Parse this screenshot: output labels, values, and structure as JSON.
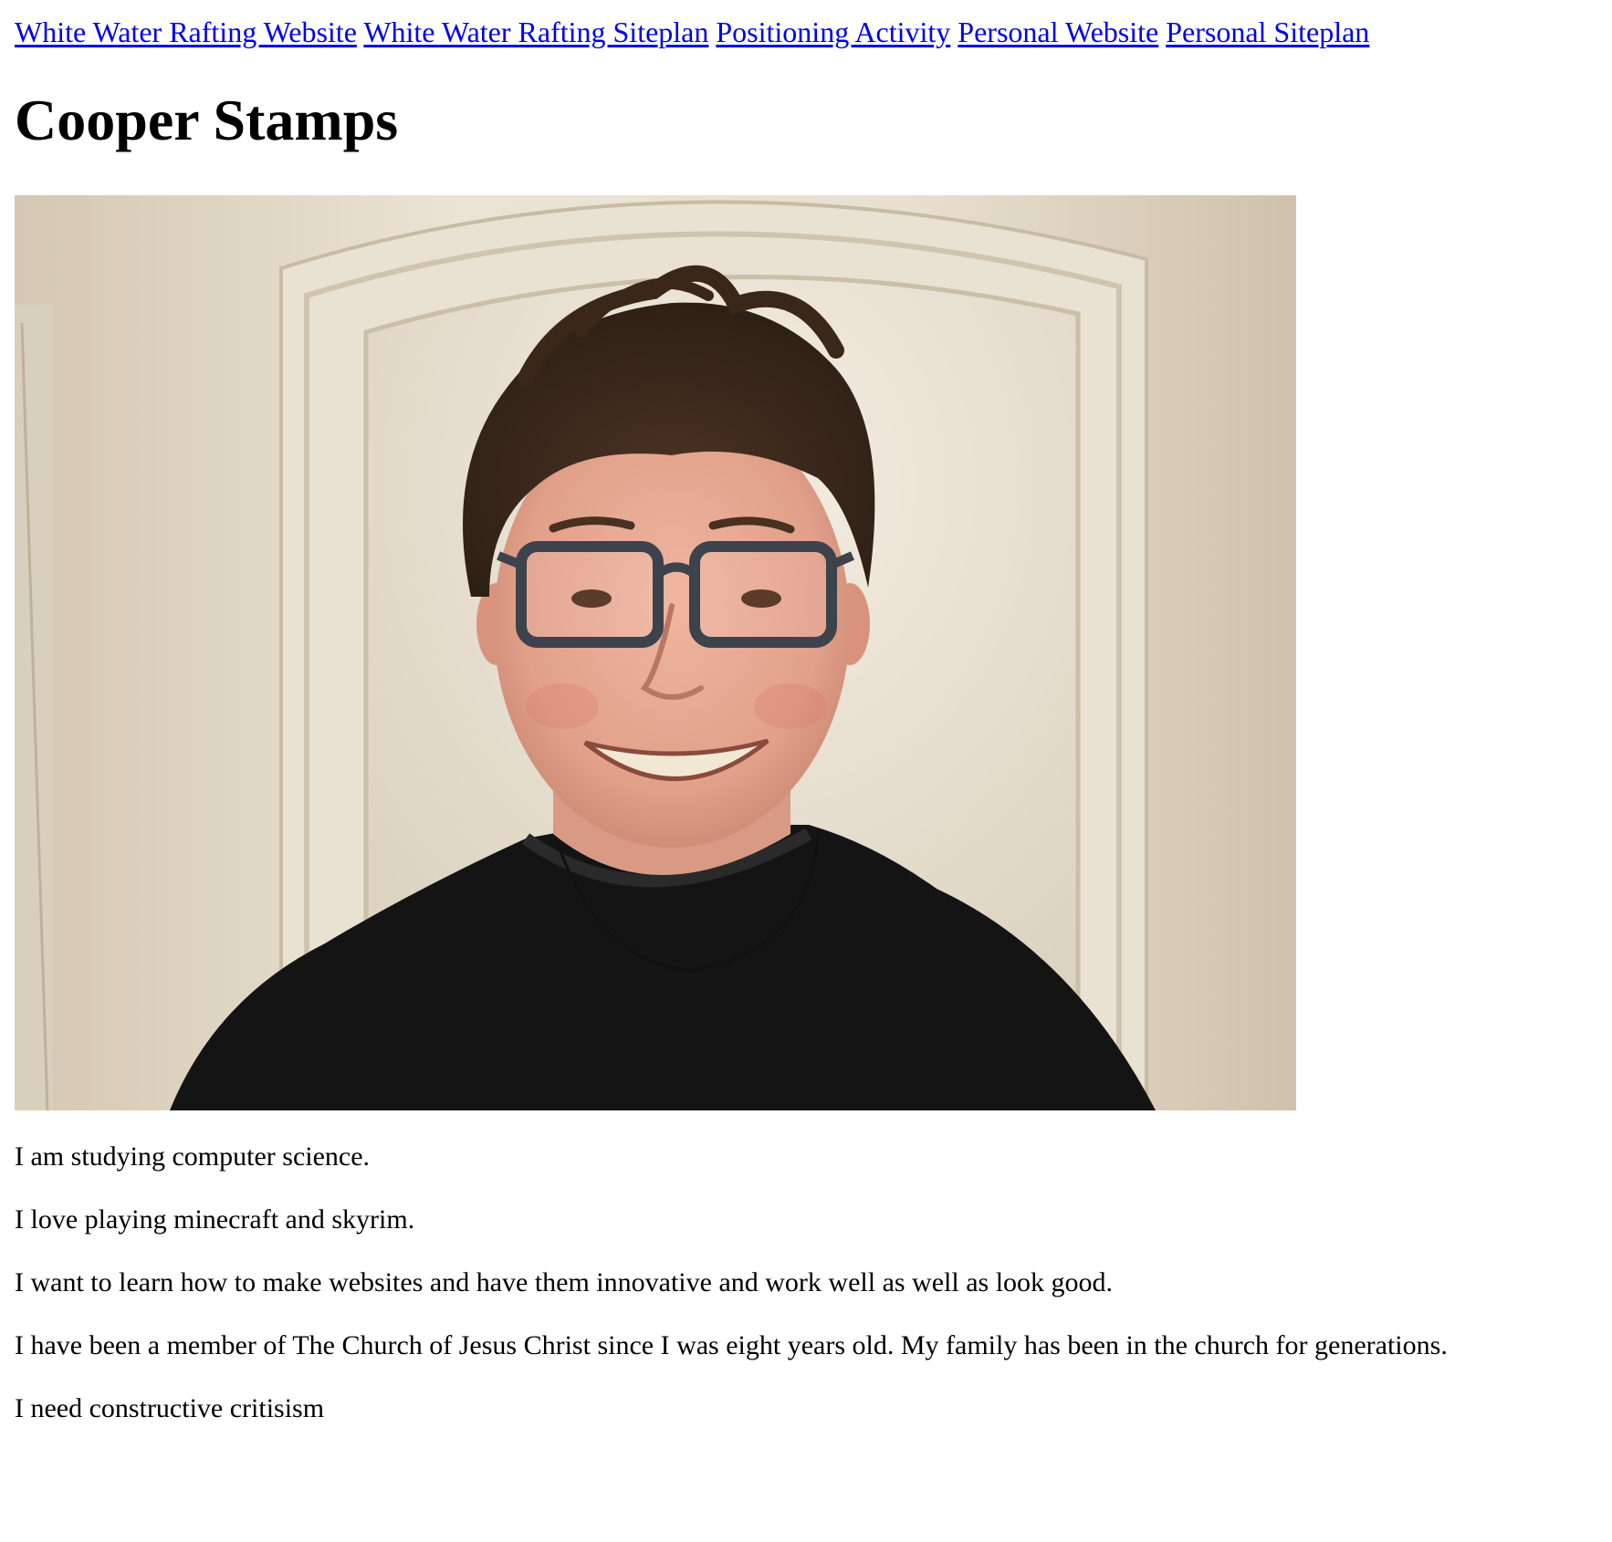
{
  "nav": {
    "links": [
      {
        "label": "White Water Rafting Website"
      },
      {
        "label": "White Water Rafting Siteplan"
      },
      {
        "label": "Positioning Activity"
      },
      {
        "label": "Personal Website"
      },
      {
        "label": "Personal Siteplan"
      }
    ]
  },
  "header": {
    "title": "Cooper Stamps"
  },
  "colors": {
    "link": "#0000ee",
    "text": "#000000",
    "background": "#ffffff"
  },
  "paragraphs": [
    "I am studying computer science.",
    "I love playing minecraft and skyrim.",
    "I want to learn how to make websites and have them innovative and work well as well as look good.",
    "I have been a member of The Church of Jesus Christ since I was eight years old. My family has been in the church for generations.",
    "I need constructive critisism"
  ]
}
